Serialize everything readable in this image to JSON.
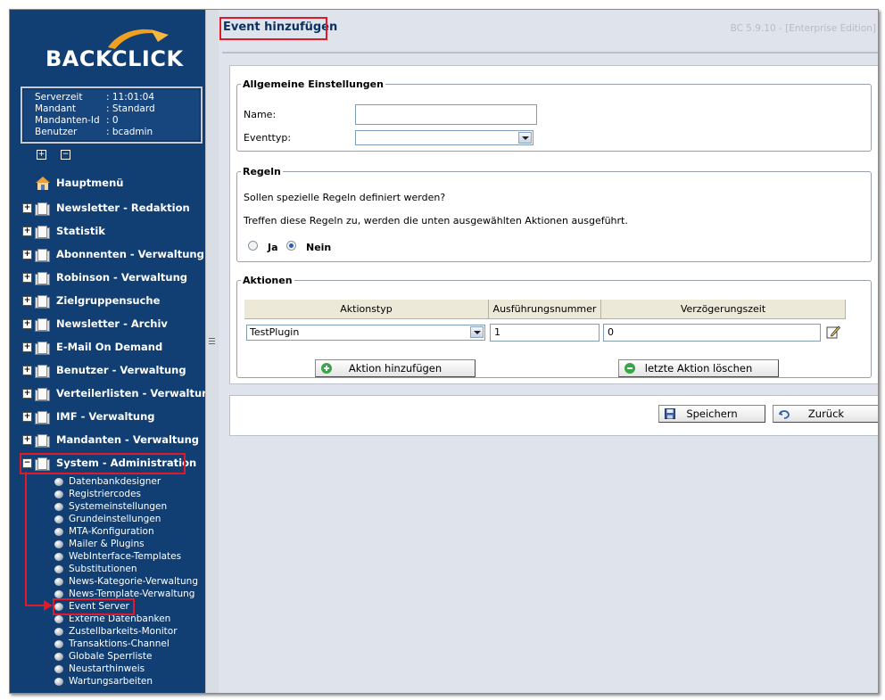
{
  "sidebar": {
    "logo_text": "BACKCLICK",
    "info": [
      {
        "key": "Serverzeit",
        "value": ": 11:01:04"
      },
      {
        "key": "Mandant",
        "value": ": Standard"
      },
      {
        "key": "Mandanten-Id",
        "value": ": 0"
      },
      {
        "key": "Benutzer",
        "value": ": bcadmin"
      }
    ],
    "expand_all_symbol": "+",
    "collapse_all_symbol": "−",
    "home_label": "Hauptmenü",
    "menu": [
      {
        "label": "Newsletter - Redaktion",
        "expander": "+"
      },
      {
        "label": "Statistik",
        "expander": "+"
      },
      {
        "label": "Abonnenten - Verwaltung",
        "expander": "+"
      },
      {
        "label": "Robinson - Verwaltung",
        "expander": "+"
      },
      {
        "label": "Zielgruppensuche",
        "expander": "+"
      },
      {
        "label": "Newsletter - Archiv",
        "expander": "+"
      },
      {
        "label": "E-Mail On Demand",
        "expander": "+"
      },
      {
        "label": "Benutzer - Verwaltung",
        "expander": "+"
      },
      {
        "label": "Verteilerlisten - Verwaltung",
        "expander": "+"
      },
      {
        "label": "IMF - Verwaltung",
        "expander": "+"
      },
      {
        "label": "Mandanten - Verwaltung",
        "expander": "+"
      },
      {
        "label": "System - Administration",
        "expander": "−"
      }
    ],
    "submenu": [
      "Datenbankdesigner",
      "Registriercodes",
      "Systemeinstellungen",
      "Grundeinstellungen",
      "MTA-Konfiguration",
      "Mailer & Plugins",
      "WebInterface-Templates",
      "Substitutionen",
      "News-Kategorie-Verwaltung",
      "News-Template-Verwaltung",
      "Event Server",
      "Externe Datenbanken",
      "Zustellbarkeits-Monitor",
      "Transaktions-Channel",
      "Globale Sperrliste",
      "Neustarthinweis",
      "Wartungsarbeiten"
    ]
  },
  "header": {
    "title": "Event hinzufügen",
    "version": "BC 5.9.10 - [Enterprise Edition]"
  },
  "general": {
    "legend": "Allgemeine Einstellungen",
    "name_label": "Name:",
    "name_value": "",
    "eventtype_label": "Eventtyp:",
    "eventtype_value": ""
  },
  "rules": {
    "legend": "Regeln",
    "question": "Sollen spezielle Regeln definiert werden?",
    "info": "Treffen diese Regeln zu, werden die unten ausgewählten Aktionen ausgeführt.",
    "yes_label": "Ja",
    "no_label": "Nein",
    "selected": "Nein"
  },
  "actions": {
    "legend": "Aktionen",
    "columns": [
      "Aktionstyp",
      "Ausführungsnummer",
      "Verzögerungszeit"
    ],
    "row": {
      "type": "TestPlugin",
      "number": "1",
      "delay": "0"
    },
    "add_button": "Aktion hinzufügen",
    "delete_button": "letzte Aktion löschen"
  },
  "footer": {
    "save_button": "Speichern",
    "back_button": "Zurück"
  },
  "colors": {
    "sidebar_bg": "#123f73",
    "highlight": "#e0192b",
    "title": "#0c3264"
  }
}
